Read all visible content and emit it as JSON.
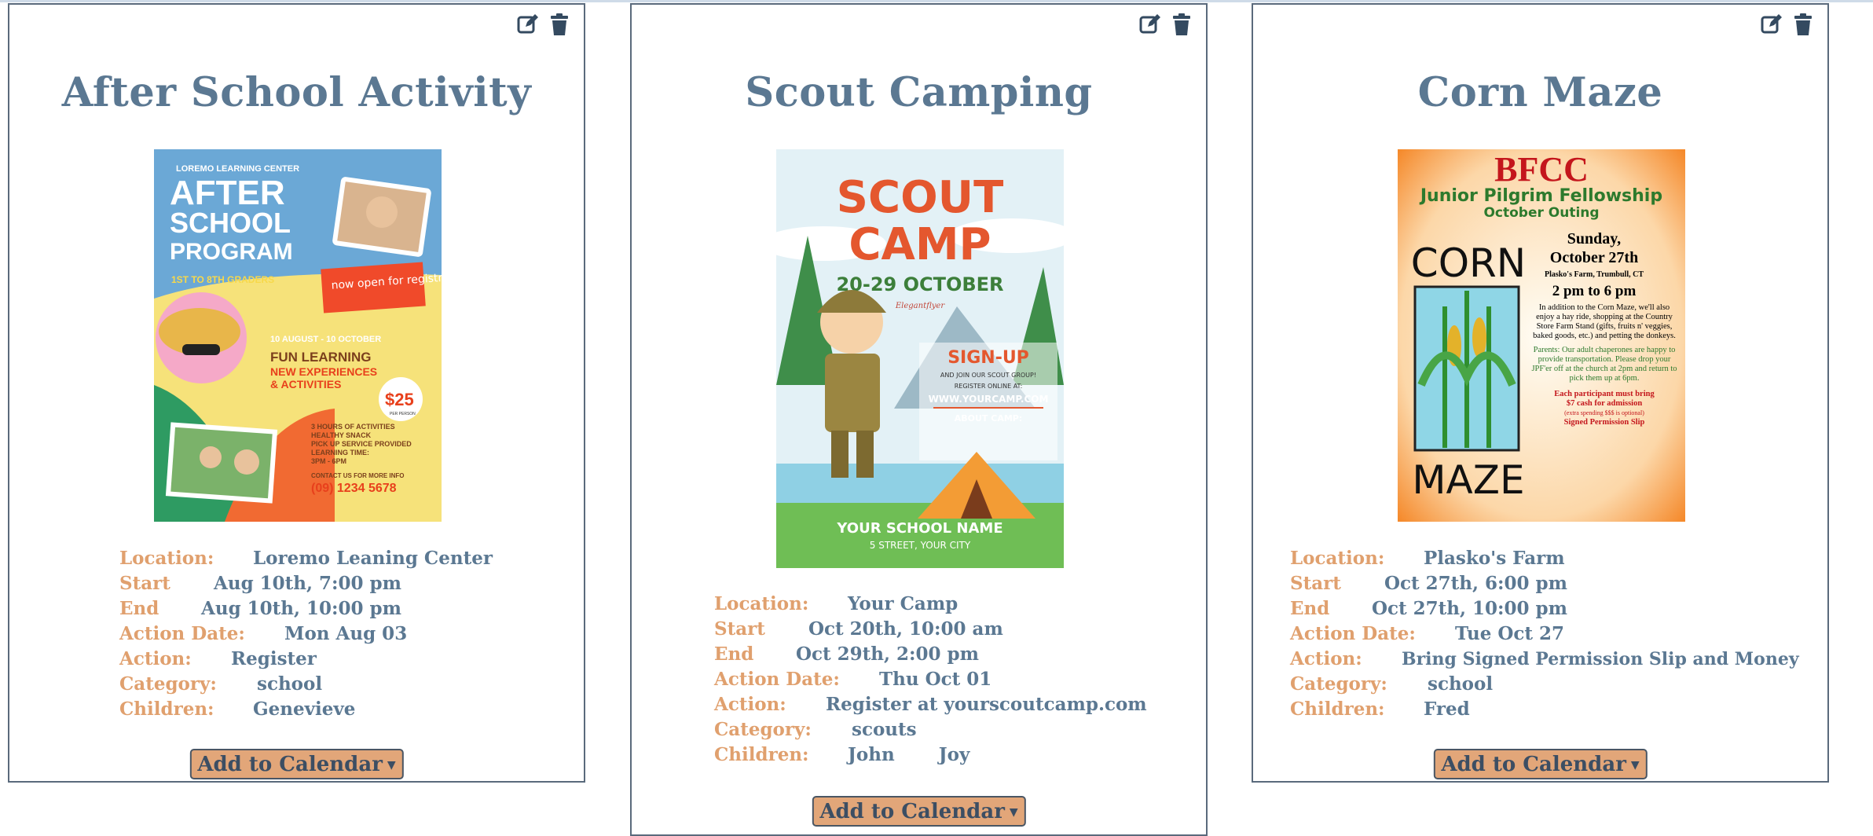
{
  "cards": [
    {
      "title": "After School Activity",
      "poster": {
        "org": "LOREMO LEARNING CENTER",
        "line1": "AFTER",
        "line2": "SCHOOL",
        "line3": "PROGRAM",
        "grades": "1ST TO 8TH GRADERS",
        "open": "now open for registration",
        "dates": "10 AUGUST - 10 OCTOBER",
        "fun": "FUN LEARNING",
        "new1": "NEW EXPERIENCES",
        "new2": "& ACTIVITIES",
        "price": "$25",
        "price_sub": "PER PERSON",
        "bullets": [
          "3 HOURS OF ACTIVITIES",
          "HEALTHY SNACK",
          "PICK UP SERVICE PROVIDED",
          "LEARNING TIME:",
          "3PM - 6PM"
        ],
        "contact": "CONTACT US FOR MORE INFO",
        "phone": "(09) 1234 5678"
      },
      "fields": [
        {
          "label": "Location:",
          "value": "Loremo Leaning Center"
        },
        {
          "label": "Start",
          "value": "Aug 10th, 7:00 pm"
        },
        {
          "label": "End",
          "value": "Aug 10th, 10:00 pm"
        },
        {
          "label": "Action Date:",
          "value": "Mon Aug 03"
        },
        {
          "label": "Action:",
          "value": "Register"
        },
        {
          "label": "Category:",
          "value": "school"
        },
        {
          "label": "Children:",
          "value": "Genevieve"
        }
      ],
      "add_label": "Add to Calendar"
    },
    {
      "title": "Scout Camping",
      "poster": {
        "line1": "SCOUT",
        "line2": "CAMP",
        "dates": "20-29 OCTOBER",
        "brand": "Elegantflyer",
        "signup": "SIGN-UP",
        "join": "AND JOIN OUR SCOUT GROUP!",
        "register": "REGISTER ONLINE AT:",
        "url": "WWW.YOURCAMP.COM",
        "about": "ABOUT CAMP:",
        "school": "YOUR SCHOOL NAME",
        "street": "5 STREET, YOUR CITY"
      },
      "fields": [
        {
          "label": "Location:",
          "value": "Your Camp"
        },
        {
          "label": "Start",
          "value": "Oct 20th, 10:00 am"
        },
        {
          "label": "End",
          "value": "Oct 29th, 2:00 pm"
        },
        {
          "label": "Action Date:",
          "value": "Thu Oct 01"
        },
        {
          "label": "Action:",
          "value": "Register at yourscoutcamp.com"
        },
        {
          "label": "Category:",
          "value": "scouts"
        },
        {
          "label": "Children:",
          "value": "John       Joy"
        }
      ],
      "add_label": "Add to Calendar"
    },
    {
      "title": "Corn Maze",
      "poster": {
        "head": "BFCC",
        "sub1": "Junior Pilgrim Fellowship",
        "sub2": "October Outing",
        "day": "Sunday,",
        "date": "October 27th",
        "place": "Plasko's Farm, Trumbull, CT",
        "time": "2 pm to 6 pm",
        "corn": "CORN",
        "maze": "MAZE",
        "body": "In addition to the Corn Maze, we'll also enjoy a hay ride, shopping at the Country Store Farm Stand (gifts, fruits n' veggies, baked goods, etc.) and petting the donkeys.",
        "parents": "Parents: Our adult chaperones are happy to provide transportation. Please drop your JPF'er off at the church at 2pm and return to pick them up at 6pm.",
        "each1": "Each participant must bring",
        "each2": "$7 cash for admission",
        "each3": "(extra spending $$$ is optional)",
        "slip": "Signed Permission Slip"
      },
      "fields": [
        {
          "label": "Location:",
          "value": "Plasko's Farm"
        },
        {
          "label": "Start",
          "value": "Oct 27th, 6:00 pm"
        },
        {
          "label": "End",
          "value": "Oct 27th, 10:00 pm"
        },
        {
          "label": "Action Date:",
          "value": "Tue Oct 27"
        },
        {
          "label": "Action:",
          "value": "Bring Signed Permission Slip and Money"
        },
        {
          "label": "Category:",
          "value": "school"
        },
        {
          "label": "Children:",
          "value": "Fred"
        }
      ],
      "add_label": "Add to Calendar"
    }
  ],
  "icons": {
    "edit": "edit-icon",
    "delete": "trash-icon",
    "caret": "caret-down-icon"
  },
  "colors": {
    "title": "#5b7892",
    "label": "#e0a06e",
    "value": "#5b7892",
    "button": "#e2a679",
    "border": "#5a6a7c"
  }
}
